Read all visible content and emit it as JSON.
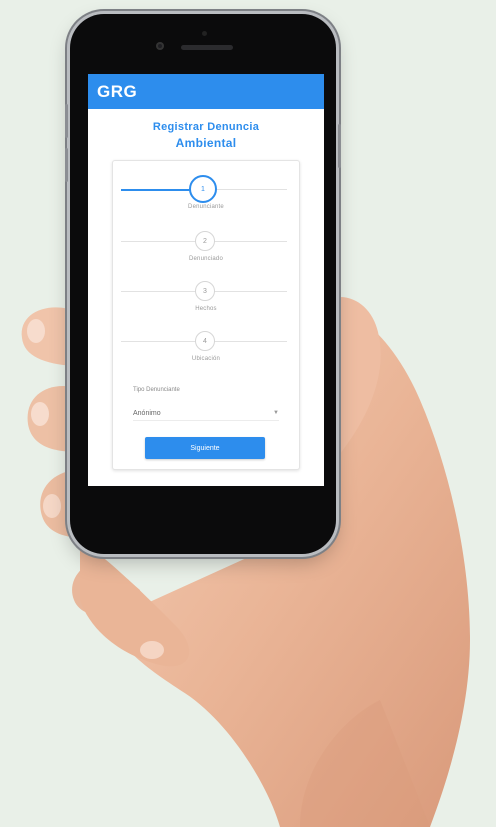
{
  "app": {
    "logo_text": "GRG",
    "brand_color": "#2d8ded"
  },
  "form": {
    "title_line1": "Registrar Denuncia",
    "title_line2": "Ambiental",
    "steps": [
      {
        "number": "1",
        "label": "Denunciante",
        "state": "active"
      },
      {
        "number": "2",
        "label": "Denunciado",
        "state": "pending"
      },
      {
        "number": "3",
        "label": "Hechos",
        "state": "pending"
      },
      {
        "number": "4",
        "label": "Ubicación",
        "state": "pending"
      }
    ],
    "field_label": "Tipo Denunciante",
    "select_value": "Anónimo",
    "button_label": "Siguiente"
  }
}
